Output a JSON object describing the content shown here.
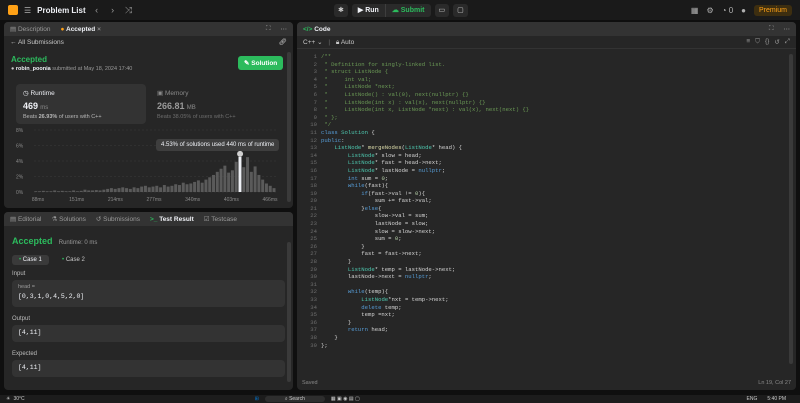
{
  "topbar": {
    "title": "Problem List",
    "run_label": "Run",
    "submit_label": "Submit",
    "premium_label": "Premium",
    "streak_count": "0"
  },
  "left": {
    "tabs": [
      "Description",
      "Accepted"
    ],
    "back_label": "All Submissions",
    "status": "Accepted",
    "author": "robin_poonia",
    "submitted_text": "submitted at May 18, 2024 17:40",
    "solution_label": "Solution",
    "runtime": {
      "label": "Runtime",
      "value": "469",
      "unit": "ms",
      "beats_prefix": "Beats",
      "beats_value": "26.93%",
      "beats_suffix": "of users with C++"
    },
    "memory": {
      "label": "Memory",
      "value": "266.81",
      "unit": "MB",
      "beats_prefix": "Beats",
      "beats_value": "38.05%",
      "beats_suffix": "of users with C++"
    },
    "tooltip": "4.53% of solutions used 440 ms of runtime"
  },
  "chart_data": {
    "type": "bar",
    "y_ticks": [
      "8%",
      "6%",
      "4%",
      "2%",
      "0%"
    ],
    "x_ticks": [
      "88ms",
      "151ms",
      "214ms",
      "277ms",
      "340ms",
      "403ms",
      "466ms"
    ],
    "ylim": [
      0,
      8
    ],
    "highlight": "440 ms",
    "values": [
      0.1,
      0.1,
      0.15,
      0.1,
      0.1,
      0.2,
      0.1,
      0.15,
      0.1,
      0.1,
      0.2,
      0.1,
      0.15,
      0.3,
      0.2,
      0.2,
      0.25,
      0.2,
      0.3,
      0.4,
      0.5,
      0.4,
      0.5,
      0.6,
      0.5,
      0.4,
      0.6,
      0.5,
      0.7,
      0.8,
      0.6,
      0.7,
      0.8,
      0.6,
      0.9,
      0.7,
      0.8,
      1.0,
      0.9,
      1.2,
      1.0,
      1.1,
      1.3,
      1.5,
      1.2,
      1.6,
      1.9,
      2.2,
      2.6,
      3.0,
      3.4,
      2.5,
      2.8,
      3.9,
      4.53,
      3.2,
      4.5,
      2.6,
      3.3,
      2.2,
      1.6,
      1.1,
      0.8,
      0.5
    ],
    "highlight_index": 54
  },
  "bottom": {
    "tabs": [
      "Editorial",
      "Solutions",
      "Submissions",
      "Test Result",
      "Testcase"
    ],
    "status": "Accepted",
    "runtime_text": "Runtime: 0 ms",
    "cases": [
      "Case 1",
      "Case 2"
    ],
    "input_label": "Input",
    "input_var": "head =",
    "input_value": "[0,3,1,0,4,5,2,0]",
    "output_label": "Output",
    "output_value": "[4,11]",
    "expected_label": "Expected",
    "expected_value": "[4,11]"
  },
  "code": {
    "title": "Code",
    "language": "C++",
    "mode": "Auto",
    "saved": "Saved",
    "cursor": "Ln 19, Col 27",
    "lines": [
      "/**",
      " * Definition for singly-linked list.",
      " * struct ListNode {",
      " *     int val;",
      " *     ListNode *next;",
      " *     ListNode() : val(0), next(nullptr) {}",
      " *     ListNode(int x) : val(x), next(nullptr) {}",
      " *     ListNode(int x, ListNode *next) : val(x), next(next) {}",
      " * };",
      " */",
      "class Solution {",
      "public:",
      "    ListNode* mergeNodes(ListNode* head) {",
      "        ListNode* slow = head;",
      "        ListNode* fast = head->next;",
      "        ListNode* lastNode = nullptr;",
      "        int sum = 0;",
      "        while(fast){",
      "            if(fast->val != 0){",
      "                sum += fast->val;",
      "            }else{",
      "                slow->val = sum;",
      "                lastNode = slow;",
      "                slow = slow->next;",
      "                sum = 0;",
      "            }",
      "            fast = fast->next;",
      "        }",
      "        ListNode* temp = lastNode->next;",
      "        lastNode->next = nullptr;",
      "",
      "        while(temp){",
      "            ListNode*nxt = temp->next;",
      "            delete temp;",
      "            temp =nxt;",
      "        }",
      "        return head;",
      "    }",
      "};"
    ]
  },
  "taskbar": {
    "weather": "30°C",
    "search": "Search",
    "lang": "ENG",
    "time": "5:40 PM"
  },
  "colors": {
    "accent": "#2cbb5d",
    "brand": "#ffa116",
    "highlight_bar": "#eff1f6",
    "bar": "#5a5a5a"
  }
}
